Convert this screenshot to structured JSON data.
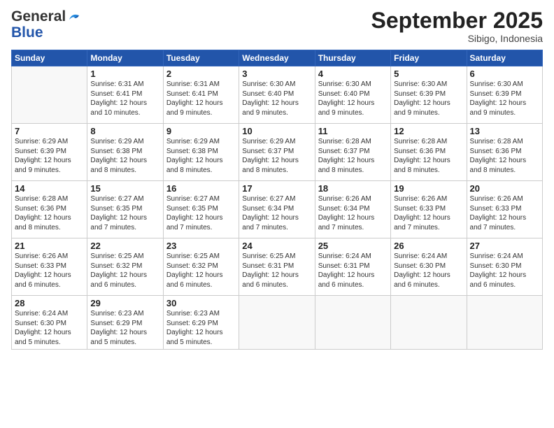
{
  "logo": {
    "general": "General",
    "blue": "Blue"
  },
  "title": "September 2025",
  "location": "Sibigo, Indonesia",
  "days": [
    "Sunday",
    "Monday",
    "Tuesday",
    "Wednesday",
    "Thursday",
    "Friday",
    "Saturday"
  ],
  "weeks": [
    [
      {
        "day": "",
        "content": ""
      },
      {
        "day": "1",
        "content": "Sunrise: 6:31 AM\nSunset: 6:41 PM\nDaylight: 12 hours\nand 10 minutes."
      },
      {
        "day": "2",
        "content": "Sunrise: 6:31 AM\nSunset: 6:41 PM\nDaylight: 12 hours\nand 9 minutes."
      },
      {
        "day": "3",
        "content": "Sunrise: 6:30 AM\nSunset: 6:40 PM\nDaylight: 12 hours\nand 9 minutes."
      },
      {
        "day": "4",
        "content": "Sunrise: 6:30 AM\nSunset: 6:40 PM\nDaylight: 12 hours\nand 9 minutes."
      },
      {
        "day": "5",
        "content": "Sunrise: 6:30 AM\nSunset: 6:39 PM\nDaylight: 12 hours\nand 9 minutes."
      },
      {
        "day": "6",
        "content": "Sunrise: 6:30 AM\nSunset: 6:39 PM\nDaylight: 12 hours\nand 9 minutes."
      }
    ],
    [
      {
        "day": "7",
        "content": "Sunrise: 6:29 AM\nSunset: 6:39 PM\nDaylight: 12 hours\nand 9 minutes."
      },
      {
        "day": "8",
        "content": "Sunrise: 6:29 AM\nSunset: 6:38 PM\nDaylight: 12 hours\nand 8 minutes."
      },
      {
        "day": "9",
        "content": "Sunrise: 6:29 AM\nSunset: 6:38 PM\nDaylight: 12 hours\nand 8 minutes."
      },
      {
        "day": "10",
        "content": "Sunrise: 6:29 AM\nSunset: 6:37 PM\nDaylight: 12 hours\nand 8 minutes."
      },
      {
        "day": "11",
        "content": "Sunrise: 6:28 AM\nSunset: 6:37 PM\nDaylight: 12 hours\nand 8 minutes."
      },
      {
        "day": "12",
        "content": "Sunrise: 6:28 AM\nSunset: 6:36 PM\nDaylight: 12 hours\nand 8 minutes."
      },
      {
        "day": "13",
        "content": "Sunrise: 6:28 AM\nSunset: 6:36 PM\nDaylight: 12 hours\nand 8 minutes."
      }
    ],
    [
      {
        "day": "14",
        "content": "Sunrise: 6:28 AM\nSunset: 6:36 PM\nDaylight: 12 hours\nand 8 minutes."
      },
      {
        "day": "15",
        "content": "Sunrise: 6:27 AM\nSunset: 6:35 PM\nDaylight: 12 hours\nand 7 minutes."
      },
      {
        "day": "16",
        "content": "Sunrise: 6:27 AM\nSunset: 6:35 PM\nDaylight: 12 hours\nand 7 minutes."
      },
      {
        "day": "17",
        "content": "Sunrise: 6:27 AM\nSunset: 6:34 PM\nDaylight: 12 hours\nand 7 minutes."
      },
      {
        "day": "18",
        "content": "Sunrise: 6:26 AM\nSunset: 6:34 PM\nDaylight: 12 hours\nand 7 minutes."
      },
      {
        "day": "19",
        "content": "Sunrise: 6:26 AM\nSunset: 6:33 PM\nDaylight: 12 hours\nand 7 minutes."
      },
      {
        "day": "20",
        "content": "Sunrise: 6:26 AM\nSunset: 6:33 PM\nDaylight: 12 hours\nand 7 minutes."
      }
    ],
    [
      {
        "day": "21",
        "content": "Sunrise: 6:26 AM\nSunset: 6:33 PM\nDaylight: 12 hours\nand 6 minutes."
      },
      {
        "day": "22",
        "content": "Sunrise: 6:25 AM\nSunset: 6:32 PM\nDaylight: 12 hours\nand 6 minutes."
      },
      {
        "day": "23",
        "content": "Sunrise: 6:25 AM\nSunset: 6:32 PM\nDaylight: 12 hours\nand 6 minutes."
      },
      {
        "day": "24",
        "content": "Sunrise: 6:25 AM\nSunset: 6:31 PM\nDaylight: 12 hours\nand 6 minutes."
      },
      {
        "day": "25",
        "content": "Sunrise: 6:24 AM\nSunset: 6:31 PM\nDaylight: 12 hours\nand 6 minutes."
      },
      {
        "day": "26",
        "content": "Sunrise: 6:24 AM\nSunset: 6:30 PM\nDaylight: 12 hours\nand 6 minutes."
      },
      {
        "day": "27",
        "content": "Sunrise: 6:24 AM\nSunset: 6:30 PM\nDaylight: 12 hours\nand 6 minutes."
      }
    ],
    [
      {
        "day": "28",
        "content": "Sunrise: 6:24 AM\nSunset: 6:30 PM\nDaylight: 12 hours\nand 5 minutes."
      },
      {
        "day": "29",
        "content": "Sunrise: 6:23 AM\nSunset: 6:29 PM\nDaylight: 12 hours\nand 5 minutes."
      },
      {
        "day": "30",
        "content": "Sunrise: 6:23 AM\nSunset: 6:29 PM\nDaylight: 12 hours\nand 5 minutes."
      },
      {
        "day": "",
        "content": ""
      },
      {
        "day": "",
        "content": ""
      },
      {
        "day": "",
        "content": ""
      },
      {
        "day": "",
        "content": ""
      }
    ]
  ]
}
